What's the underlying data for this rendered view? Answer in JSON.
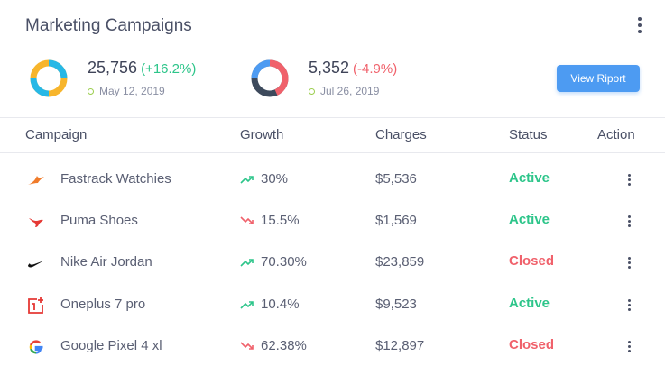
{
  "header": {
    "title": "Marketing Campaigns"
  },
  "stats": [
    {
      "value": "25,756",
      "change": "(+16.2%)",
      "date": "May 12, 2019"
    },
    {
      "value": "5,352",
      "change": "(-4.9%)",
      "date": "Jul 26, 2019"
    }
  ],
  "report_button": "View Riport",
  "table": {
    "headers": [
      "Campaign",
      "Growth",
      "Charges",
      "Status",
      "Action"
    ],
    "rows": [
      {
        "logo": "fastrack-logo",
        "name": "Fastrack Watchies",
        "growth": "30%",
        "trend": "up",
        "charges": "$5,536",
        "status": "Active"
      },
      {
        "logo": "puma-logo",
        "name": "Puma Shoes",
        "growth": "15.5%",
        "trend": "down",
        "charges": "$1,569",
        "status": "Active"
      },
      {
        "logo": "nike-logo",
        "name": "Nike Air Jordan",
        "growth": "70.30%",
        "trend": "up",
        "charges": "$23,859",
        "status": "Closed"
      },
      {
        "logo": "oneplus-logo",
        "name": "Oneplus 7 pro",
        "growth": "10.4%",
        "trend": "up",
        "charges": "$9,523",
        "status": "Active"
      },
      {
        "logo": "google-logo",
        "name": "Google Pixel 4 xl",
        "growth": "62.38%",
        "trend": "down",
        "charges": "$12,897",
        "status": "Closed"
      }
    ]
  },
  "colors": {
    "accent": "#4d9bf2",
    "positive": "#2dc58a",
    "negative": "#f0616b"
  }
}
